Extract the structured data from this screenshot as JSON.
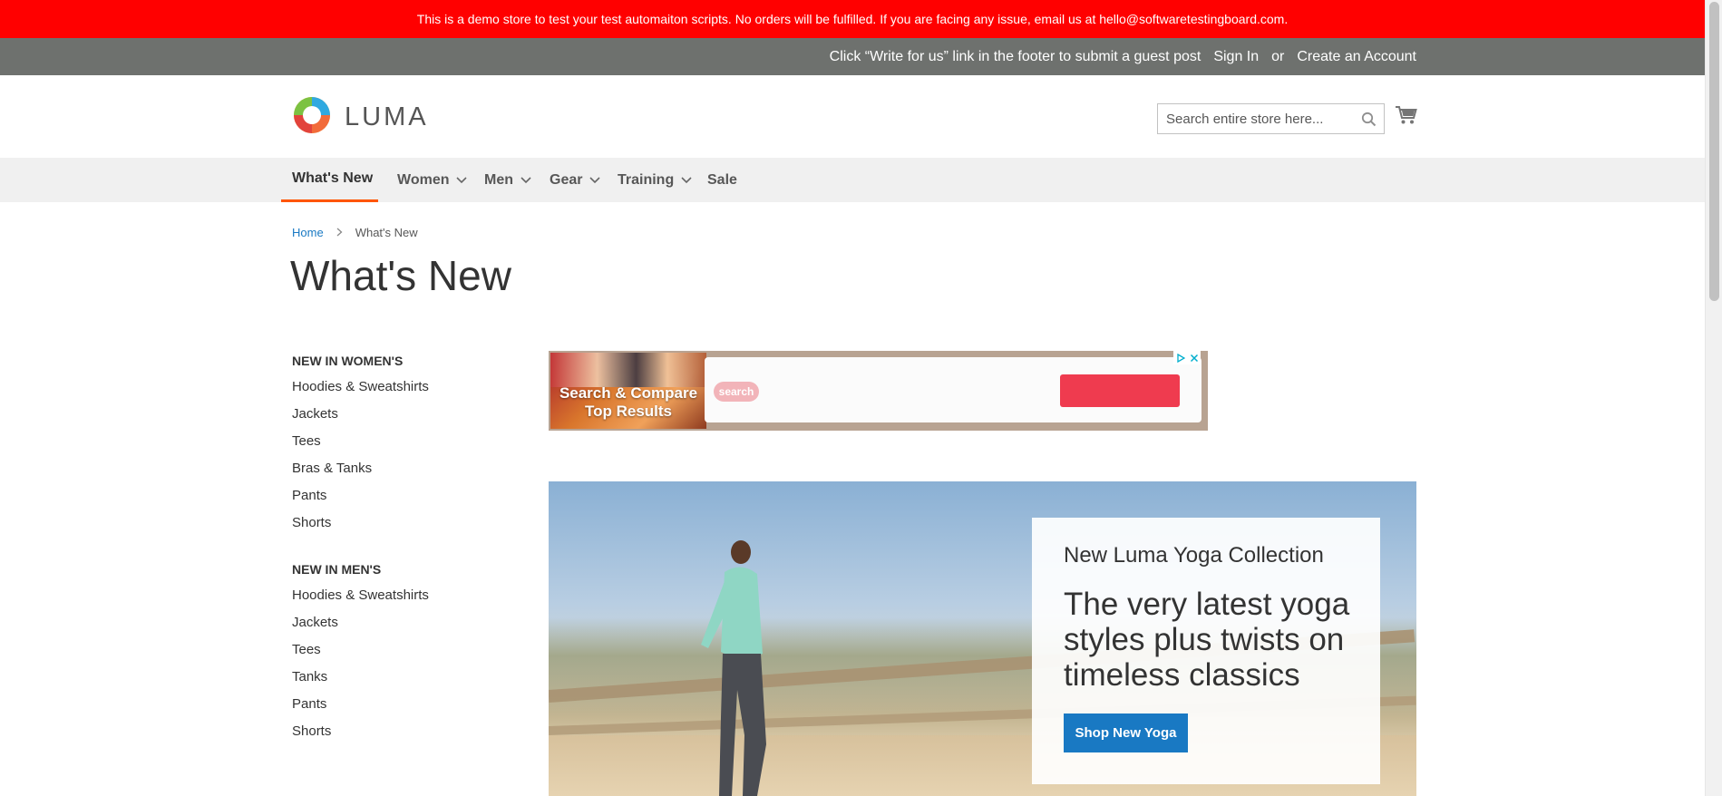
{
  "demo_banner": {
    "text": "This is a demo store to test your test automaiton scripts. No orders will be fulfilled. If you are facing any issue, email us at hello@softwaretestingboard.com."
  },
  "top_bar": {
    "guest_post_text": "Click “Write for us” link in the footer to submit a guest post",
    "sign_in": "Sign In",
    "or": "or",
    "create_account": "Create an Account"
  },
  "header": {
    "logo_text": "LUMA",
    "logo_icon": "luma-logo-icon",
    "search_placeholder": "Search entire store here...",
    "search_icon": "search-icon",
    "cart_icon": "cart-icon"
  },
  "nav": {
    "items": [
      {
        "label": "What's New",
        "active": true,
        "dropdown": false
      },
      {
        "label": "Women",
        "active": false,
        "dropdown": true
      },
      {
        "label": "Men",
        "active": false,
        "dropdown": true
      },
      {
        "label": "Gear",
        "active": false,
        "dropdown": true
      },
      {
        "label": "Training",
        "active": false,
        "dropdown": true
      },
      {
        "label": "Sale",
        "active": false,
        "dropdown": false
      }
    ],
    "accent_color": "#ff5501"
  },
  "breadcrumb": {
    "home": "Home",
    "current": "What's New"
  },
  "page_title": "What's New",
  "sidebar": {
    "sections": [
      {
        "heading": "NEW IN WOMEN'S",
        "items": [
          "Hoodies & Sweatshirts",
          "Jackets",
          "Tees",
          "Bras & Tanks",
          "Pants",
          "Shorts"
        ]
      },
      {
        "heading": "NEW IN MEN'S",
        "items": [
          "Hoodies & Sweatshirts",
          "Jackets",
          "Tees",
          "Tanks",
          "Pants",
          "Shorts"
        ]
      }
    ]
  },
  "ad": {
    "headline": "Search & Compare Top Results",
    "logo_text": "search",
    "close_icon": "close-icon",
    "adchoices_icon": "adchoices-icon"
  },
  "hero": {
    "subtitle": "New Luma Yoga Collection",
    "headline": "The very latest yoga styles plus twists on timeless classics",
    "button": "Shop New Yoga"
  },
  "colors": {
    "banner_red": "#ff0000",
    "top_bar_gray": "#6e716e",
    "link_blue": "#1979c3",
    "button_blue": "#1979c3"
  }
}
